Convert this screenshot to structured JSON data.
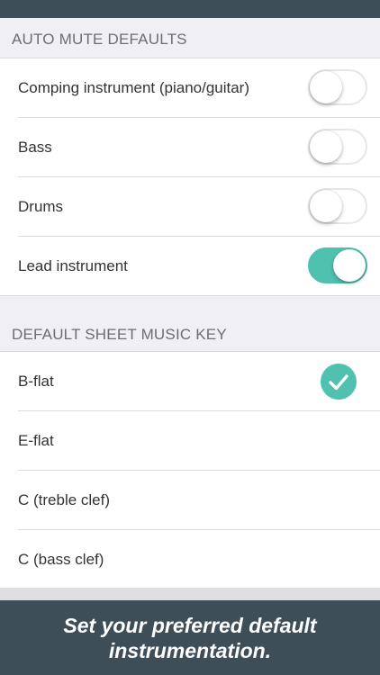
{
  "colors": {
    "header_bar": "#3d4e58",
    "accent": "#4fc1ae",
    "section_bg": "#efeff4"
  },
  "auto_mute": {
    "header": "AUTO MUTE DEFAULTS",
    "items": [
      {
        "label": "Comping instrument (piano/guitar)",
        "enabled": false
      },
      {
        "label": "Bass",
        "enabled": false
      },
      {
        "label": "Drums",
        "enabled": false
      },
      {
        "label": "Lead instrument",
        "enabled": true
      }
    ]
  },
  "sheet_key": {
    "header": "DEFAULT SHEET MUSIC KEY",
    "items": [
      {
        "label": "B-flat",
        "selected": true,
        "icon": "checkmark-icon"
      },
      {
        "label": "E-flat",
        "selected": false
      },
      {
        "label": "C (treble clef)",
        "selected": false
      },
      {
        "label": "C (bass clef)",
        "selected": false
      }
    ]
  },
  "caption": {
    "line1": "Set your preferred default",
    "line2": "instrumentation."
  }
}
